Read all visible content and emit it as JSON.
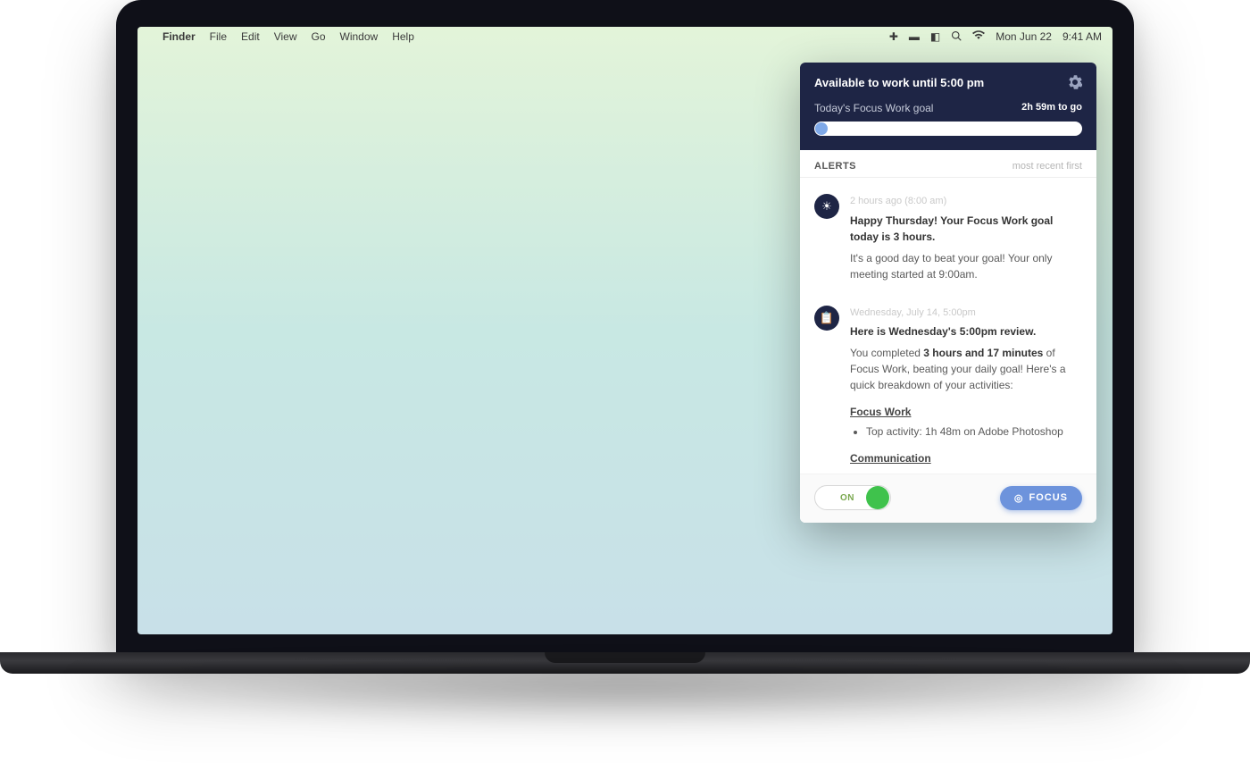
{
  "menubar": {
    "app": "Finder",
    "items": [
      "File",
      "Edit",
      "View",
      "Go",
      "Window",
      "Help"
    ],
    "date": "Mon Jun 22",
    "time": "9:41 AM"
  },
  "popover": {
    "header": {
      "title": "Available to work until 5:00 pm",
      "goal_label": "Today's Focus Work goal",
      "remaining": "2h 59m to go"
    },
    "alerts": {
      "heading": "ALERTS",
      "sort": "most recent first",
      "items": [
        {
          "icon": "sunrise",
          "timestamp": "2 hours ago (8:00 am)",
          "title": "Happy Thursday! Your Focus Work goal today is 3 hours.",
          "body": "It's a good day to beat your goal! Your only meeting started at 9:00am."
        },
        {
          "icon": "clipboard",
          "timestamp": "Wednesday, July 14, 5:00pm",
          "title": "Here is Wednesday's 5:00pm review.",
          "body_prefix": "You completed ",
          "body_bold": "3 hours and 17 minutes",
          "body_suffix": " of Focus Work, beating your daily goal! Here's a quick breakdown of your activities:",
          "sections": [
            {
              "heading": "Focus Work",
              "items": [
                "Top activity: 1h 48m on Adobe Photoshop"
              ]
            },
            {
              "heading": "Communication",
              "items": []
            }
          ]
        }
      ]
    },
    "footer": {
      "toggle_label": "ON",
      "focus_label": "FOCUS"
    }
  }
}
